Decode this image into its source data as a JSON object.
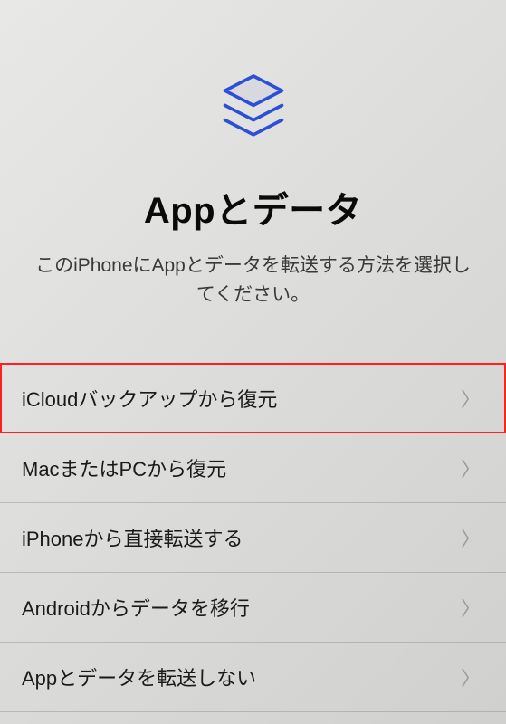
{
  "header": {
    "title": "Appとデータ",
    "subtitle": "このiPhoneにAppとデータを転送する方法を選択してください。"
  },
  "options": [
    {
      "label": "iCloudバックアップから復元",
      "highlighted": true
    },
    {
      "label": "MacまたはPCから復元",
      "highlighted": false
    },
    {
      "label": "iPhoneから直接転送する",
      "highlighted": false
    },
    {
      "label": "Androidからデータを移行",
      "highlighted": false
    },
    {
      "label": "Appとデータを転送しない",
      "highlighted": false
    }
  ],
  "colors": {
    "accent": "#2b4fd8",
    "highlight_border": "#ff2020"
  }
}
